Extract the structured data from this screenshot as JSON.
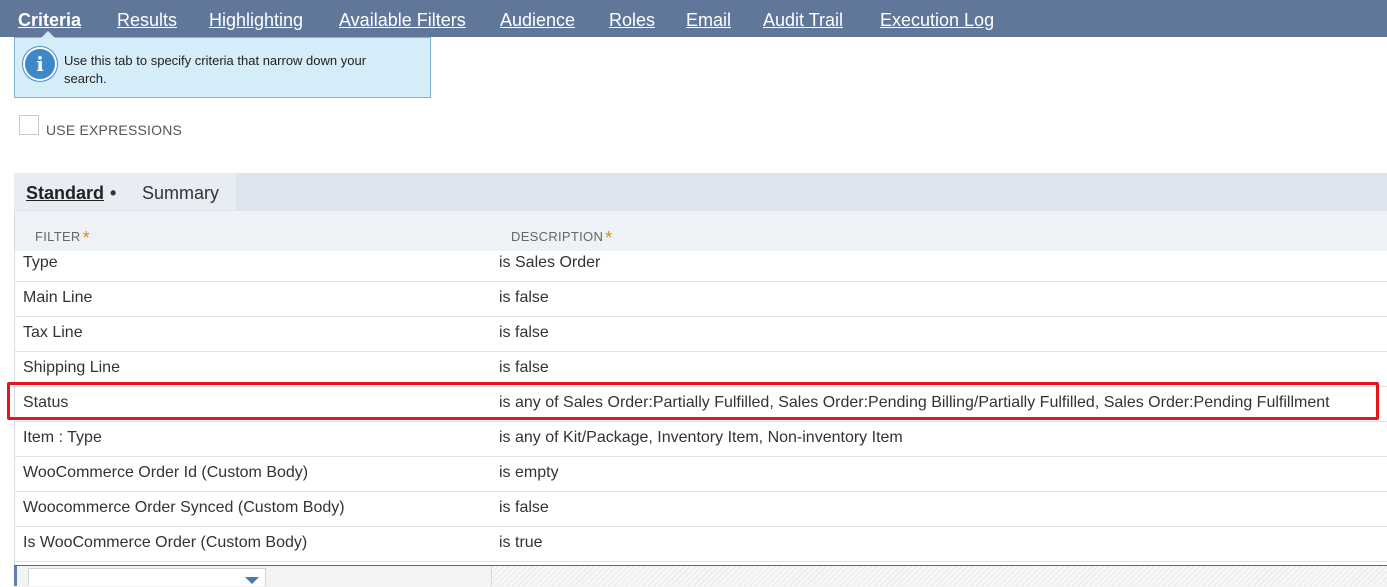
{
  "top_tabs": [
    {
      "label": "Criteria",
      "active": true
    },
    {
      "label": "Results"
    },
    {
      "label": "Highlighting"
    },
    {
      "label": "Available Filters"
    },
    {
      "label": "Audience"
    },
    {
      "label": "Roles"
    },
    {
      "label": "Email"
    },
    {
      "label": "Audit Trail"
    },
    {
      "label": "Execution Log"
    }
  ],
  "info": {
    "icon": "info-icon",
    "text": "Use this tab to specify criteria that narrow down your search."
  },
  "use_expressions": {
    "label": "USE EXPRESSIONS",
    "checked": false
  },
  "sub_tabs": {
    "standard": "Standard",
    "standard_marker": "•",
    "summary": "Summary"
  },
  "table": {
    "headers": {
      "filter": "FILTER",
      "description": "DESCRIPTION",
      "required_marker": "*"
    },
    "rows": [
      {
        "filter": "Type",
        "description": "is Sales Order"
      },
      {
        "filter": "Main Line",
        "description": "is false"
      },
      {
        "filter": "Tax Line",
        "description": "is false"
      },
      {
        "filter": "Shipping Line",
        "description": "is false"
      },
      {
        "filter": "Status",
        "description": "is any of Sales Order:Partially Fulfilled, Sales Order:Pending Billing/Partially Fulfilled, Sales Order:Pending Fulfillment"
      },
      {
        "filter": "Item : Type",
        "description": "is any of Kit/Package, Inventory Item, Non-inventory Item"
      },
      {
        "filter": "WooCommerce Order Id (Custom Body)",
        "description": "is empty"
      },
      {
        "filter": "Woocommerce Order Synced (Custom Body)",
        "description": "is false"
      },
      {
        "filter": "Is WooCommerce Order (Custom Body)",
        "description": "is true"
      }
    ]
  },
  "colors": {
    "tab_bar": "#607799",
    "info_bg": "#d4edf8",
    "highlight": "#e8141b",
    "required_star": "#e08a22"
  }
}
